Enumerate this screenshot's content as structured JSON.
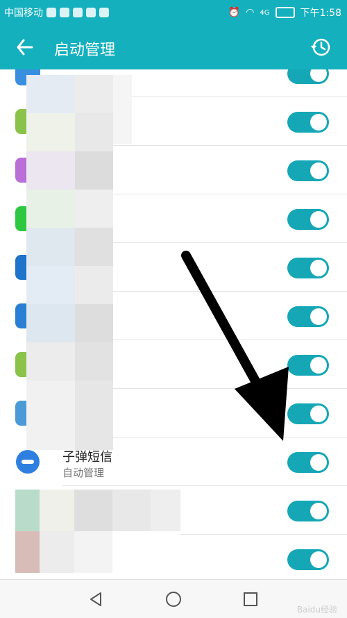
{
  "status_bar": {
    "carrier": "中国移动",
    "time": "下午1:58",
    "signal": "4G"
  },
  "header": {
    "title": "启动管理"
  },
  "highlight_app": {
    "name": "子弹短信",
    "subtitle": "自动管理"
  },
  "toggles": [
    true,
    true,
    true,
    true,
    true,
    true,
    true,
    true,
    true,
    true,
    true
  ],
  "nav": {
    "back_icon": "triangle-back",
    "home_icon": "circle-home",
    "recent_icon": "square-recent"
  },
  "watermark": "Baidu经验"
}
